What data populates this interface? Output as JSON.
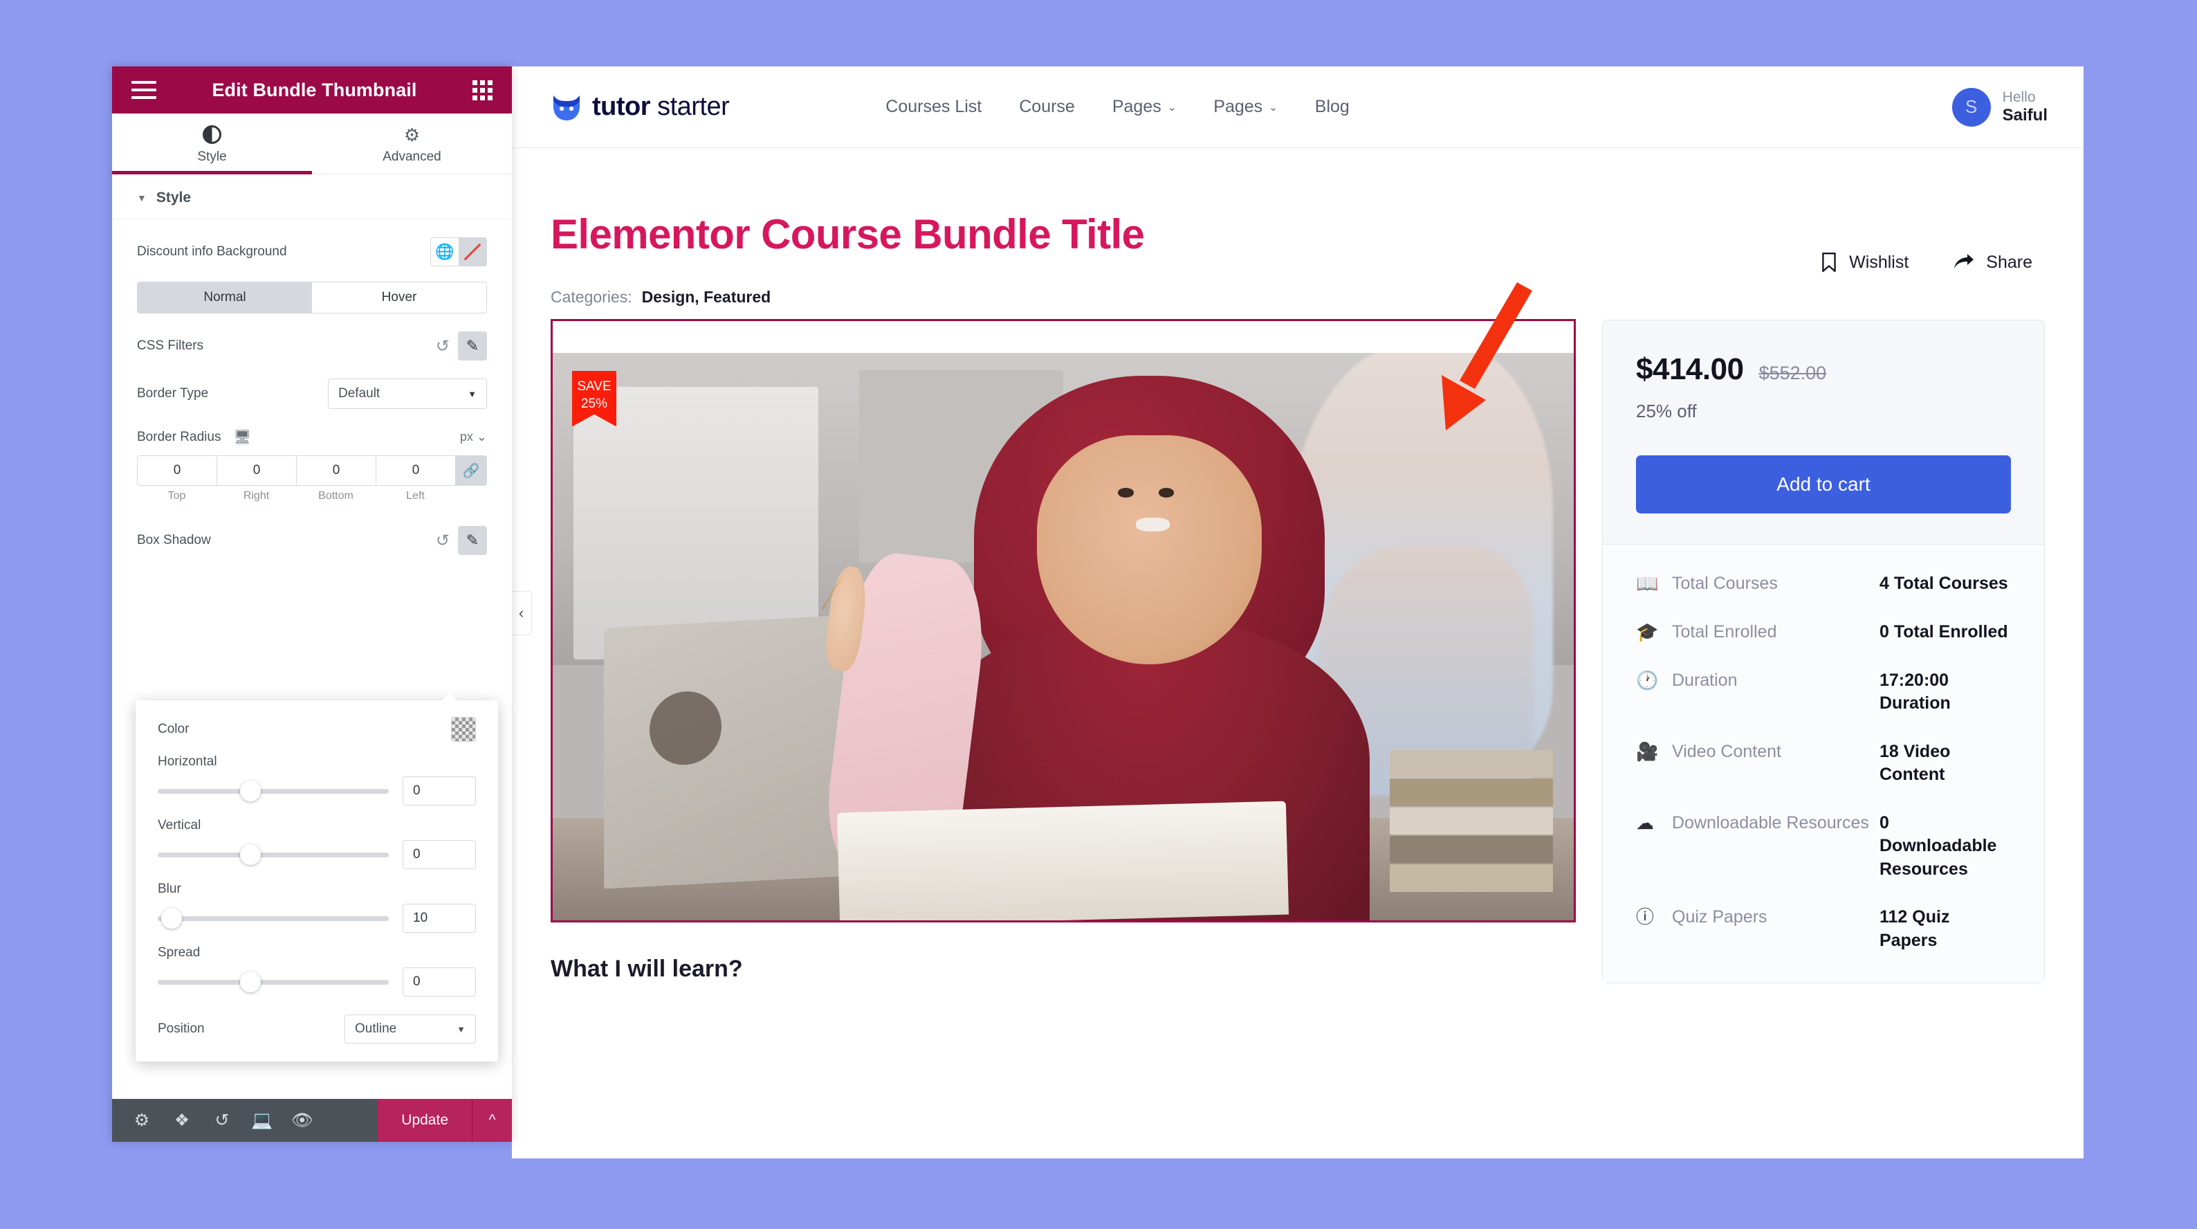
{
  "panel": {
    "title": "Edit Bundle Thumbnail",
    "menu_icon": "hamburger-icon",
    "apps_icon": "grid-apps-icon",
    "tabs": [
      {
        "label": "Style",
        "icon": "contrast-icon",
        "active": true
      },
      {
        "label": "Advanced",
        "icon": "gear-icon",
        "active": false
      }
    ],
    "section": {
      "title": "Style",
      "caret": "▼"
    },
    "controls": {
      "discount_bg_label": "Discount info Background",
      "state_tabs": [
        {
          "label": "Normal",
          "active": true
        },
        {
          "label": "Hover",
          "active": false
        }
      ],
      "css_filters_label": "CSS Filters",
      "border_type_label": "Border Type",
      "border_type_value": "Default",
      "border_radius_label": "Border Radius",
      "border_radius_unit": "px",
      "border_radius": [
        {
          "value": "0",
          "label": "Top"
        },
        {
          "value": "0",
          "label": "Right"
        },
        {
          "value": "0",
          "label": "Bottom"
        },
        {
          "value": "0",
          "label": "Left"
        }
      ],
      "box_shadow_label": "Box Shadow"
    },
    "popover": {
      "color_label": "Color",
      "sliders": [
        {
          "label": "Horizontal",
          "value": "0",
          "percent": 40
        },
        {
          "label": "Vertical",
          "value": "0",
          "percent": 40
        },
        {
          "label": "Blur",
          "value": "10",
          "percent": 6
        },
        {
          "label": "Spread",
          "value": "0",
          "percent": 40
        }
      ],
      "position_label": "Position",
      "position_value": "Outline"
    },
    "footer": {
      "icons": [
        "settings-gear-icon",
        "layers-navigator-icon",
        "history-icon",
        "responsive-mode-icon",
        "preview-eye-icon"
      ],
      "update_label": "Update",
      "caret": "⌃"
    },
    "accent_color": "#9b0a46",
    "update_color": "#b7235c"
  },
  "site": {
    "logo": {
      "bold": "tutor",
      "light": " starter",
      "icon": "owl-logo-icon"
    },
    "nav": [
      {
        "label": "Courses List",
        "has_caret": false
      },
      {
        "label": "Course",
        "has_caret": false
      },
      {
        "label": "Pages",
        "has_caret": true
      },
      {
        "label": "Pages",
        "has_caret": true
      },
      {
        "label": "Blog",
        "has_caret": false
      }
    ],
    "user": {
      "initial": "S",
      "greeting": "Hello",
      "name": "Saiful"
    }
  },
  "course": {
    "title": "Elementor Course Bundle Title",
    "categories_label": "Categories:",
    "categories_value": "Design, Featured",
    "ribbon": {
      "line1": "SAVE",
      "line2": "25%",
      "color": "#fa1e0a"
    },
    "actions": [
      {
        "label": "Wishlist",
        "icon": "bookmark-icon"
      },
      {
        "label": "Share",
        "icon": "share-arrow-icon"
      }
    ],
    "price": {
      "current": "$414.00",
      "original": "$552.00",
      "discount_text": "25% off",
      "cart_label": "Add to cart",
      "cart_color": "#3c5fe0"
    },
    "meta": [
      {
        "icon": "book-open-icon",
        "key": "Total Courses",
        "value": "4 Total Courses"
      },
      {
        "icon": "graduation-cap-icon",
        "key": "Total Enrolled",
        "value": "0 Total Enrolled"
      },
      {
        "icon": "clock-icon",
        "key": "Duration",
        "value": "17:20:00 Duration"
      },
      {
        "icon": "video-camera-icon",
        "key": "Video Content",
        "value": "18 Video Content"
      },
      {
        "icon": "cloud-download-icon",
        "key": "Downloadable Resources",
        "value": "0 Downloadable Resources"
      },
      {
        "icon": "question-circle-icon",
        "key": "Quiz Papers",
        "value": "112 Quiz Papers"
      }
    ],
    "learn_heading": "What I will learn?"
  },
  "annotation": {
    "arrow_color": "#f4310f"
  }
}
